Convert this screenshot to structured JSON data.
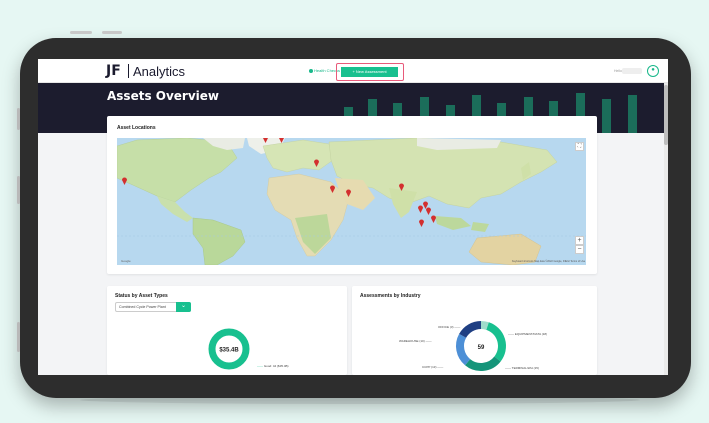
{
  "app": {
    "logo_mark": "JF",
    "logo_text": "Analytics"
  },
  "header": {
    "nav_link": "Health Checks",
    "new_button": "+ New Assessment",
    "user_label": "Hello",
    "user_icon": "user-icon"
  },
  "page": {
    "title": "Assets Overview"
  },
  "map_card": {
    "title": "Asset Locations",
    "fullscreen_icon": "fullscreen-icon",
    "zoom_in": "+",
    "zoom_out": "−",
    "google": "Google",
    "attribution": "Keyboard shortcuts   Map data ©2022 Google, INEGI   Terms of Use",
    "markers": 12
  },
  "status_card": {
    "title": "Status by Asset Types",
    "select_value": "Combined Cycle Power Plant",
    "chevron_icon": "chevron-down-icon",
    "donut_center": "$35.4B",
    "legend_label": "Good: 44 ($35.4B)"
  },
  "industry_card": {
    "title": "Assessments by Industry",
    "donut_center": "59",
    "labels": {
      "top": "OFFICE (3)",
      "left": "WAREHOUSE (10)",
      "bottom_left": "CCPP (13)",
      "right": "EQUIPMENT/DATA (18)",
      "bottom_right": "TERMINAL/WH (15)"
    }
  },
  "chart_data": [
    {
      "type": "pie",
      "title": "Status by Asset Types",
      "center_label": "$35.4B",
      "slices": [
        {
          "label": "Good: 44 ($35.4B)",
          "value": 100
        }
      ],
      "colors": [
        "#18c08f"
      ]
    },
    {
      "type": "pie",
      "title": "Assessments by Industry",
      "center_label": "59",
      "slices": [
        {
          "label": "OFFICE (3)",
          "value": 3
        },
        {
          "label": "EQUIPMENT/DATA (18)",
          "value": 18
        },
        {
          "label": "TERMINAL/WH (15)",
          "value": 15
        },
        {
          "label": "CCPP (13)",
          "value": 13
        },
        {
          "label": "WAREHOUSE (10)",
          "value": 10
        }
      ],
      "colors": [
        "#9fdccb",
        "#18c08f",
        "#15957a",
        "#4d8fd6",
        "#1f3f83"
      ]
    }
  ],
  "colors": {
    "accent": "#18c08f",
    "hero_bg": "#1c1c2e",
    "highlight": "#e85a7a",
    "marker": "#d32f2f"
  }
}
